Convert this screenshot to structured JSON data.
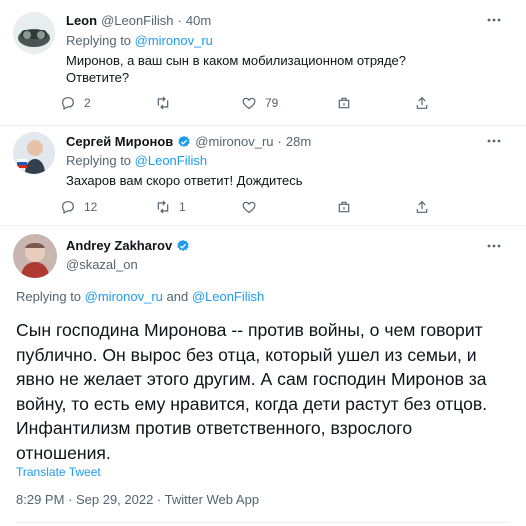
{
  "tweets": [
    {
      "name": "Leon",
      "handle": "@LeonFilish",
      "dot": "·",
      "time": "40m",
      "replying_prefix": "Replying to ",
      "replying_to": "@mironov_ru",
      "text_line1": "Миронов, а ваш сын в каком мобилизационном отряде?",
      "text_line2": "Ответите?",
      "replies": "2",
      "retweets": "",
      "likes": "79"
    },
    {
      "name": "Сергей Миронов",
      "handle": "@mironov_ru",
      "dot": "·",
      "time": "28m",
      "replying_prefix": "Replying to ",
      "replying_to": "@LeonFilish",
      "text_line1": "Захаров вам скоро ответит! Дождитесь",
      "replies": "12",
      "retweets": "1",
      "likes": ""
    }
  ],
  "main": {
    "name": "Andrey Zakharov",
    "handle": "@skazal_on",
    "replying_prefix": "Replying to ",
    "replying_to_1": "@mironov_ru",
    "replying_and": " and ",
    "replying_to_2": "@LeonFilish",
    "text": "Сын господина Миронова -- против войны, о чем говорит публично. Он вырос без отца, который ушел из семьи, и явно не желает этого другим. А сам господин Миронов за войну, то есть ему нравится, когда дети растут без отцов. Инфантилизм против ответственного, взрослого отношения.",
    "translate": "Translate Tweet",
    "meta": "8:29 PM · Sep 29, 2022 · Twitter Web App"
  },
  "colors": {
    "accent": "#1d9bf0",
    "secondary_text": "#536471",
    "primary_text": "#0f1419"
  },
  "icons": [
    "more-icon",
    "reply-icon",
    "retweet-icon",
    "like-icon",
    "share-icon",
    "upload-icon",
    "verified-icon"
  ]
}
